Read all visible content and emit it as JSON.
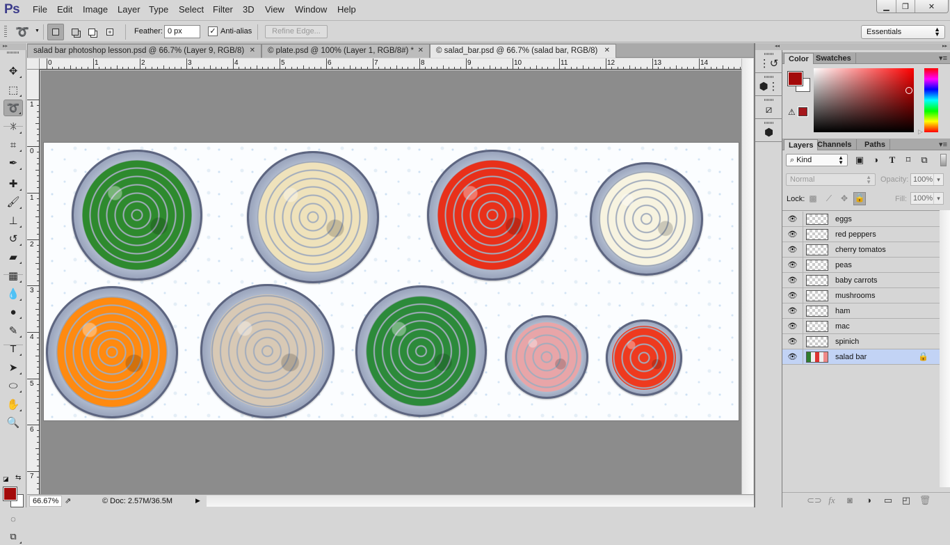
{
  "app": {
    "logo": "Ps",
    "menu": [
      "File",
      "Edit",
      "Image",
      "Layer",
      "Type",
      "Select",
      "Filter",
      "3D",
      "View",
      "Window",
      "Help"
    ],
    "window_controls": {
      "minimize": "▁",
      "restore": "❐",
      "close": "✕"
    }
  },
  "options_bar": {
    "tool_icon": "lasso-icon",
    "selection_modes": [
      "new-selection",
      "add-to-selection",
      "subtract-from-selection",
      "intersect-selection"
    ],
    "feather_label": "Feather:",
    "feather_value": "0 px",
    "antialias_label": "Anti-alias",
    "antialias_checked": true,
    "refine_edge_label": "Refine Edge...",
    "workspace": "Essentials"
  },
  "document_tabs": [
    {
      "label": "salad bar photoshop lesson.psd @ 66.7% (Layer 9, RGB/8)",
      "active": false
    },
    {
      "label": "© plate.psd @ 100% (Layer 1, RGB/8#) *",
      "active": false
    },
    {
      "label": "© salad_bar.psd @ 66.7% (salad bar, RGB/8)",
      "active": true
    }
  ],
  "rulers": {
    "top": [
      "0",
      "1",
      "2",
      "3",
      "4",
      "5",
      "6",
      "7",
      "8",
      "9",
      "10",
      "11",
      "12",
      "13",
      "14"
    ],
    "left": [
      "1",
      "0",
      "1",
      "2",
      "3",
      "4",
      "5",
      "6",
      "7"
    ]
  },
  "tools": [
    {
      "name": "move-tool",
      "glyph": "✥"
    },
    {
      "name": "marquee-tool",
      "glyph": "⬚"
    },
    {
      "name": "lasso-tool",
      "glyph": "➰",
      "active": true
    },
    {
      "name": "magic-wand-tool",
      "glyph": "✳"
    },
    {
      "name": "crop-tool",
      "glyph": "⌗"
    },
    {
      "name": "eyedropper-tool",
      "glyph": "✒"
    },
    {
      "name": "healing-brush-tool",
      "glyph": "✚"
    },
    {
      "name": "brush-tool",
      "glyph": "🖌"
    },
    {
      "name": "clone-stamp-tool",
      "glyph": "⊥"
    },
    {
      "name": "history-brush-tool",
      "glyph": "↺"
    },
    {
      "name": "eraser-tool",
      "glyph": "▰"
    },
    {
      "name": "gradient-tool",
      "glyph": "▦"
    },
    {
      "name": "blur-tool",
      "glyph": "💧"
    },
    {
      "name": "dodge-tool",
      "glyph": "●"
    },
    {
      "name": "pen-tool",
      "glyph": "✎"
    },
    {
      "name": "type-tool",
      "glyph": "T"
    },
    {
      "name": "path-selection-tool",
      "glyph": "➤"
    },
    {
      "name": "ellipse-tool",
      "glyph": "⬭"
    },
    {
      "name": "hand-tool",
      "glyph": "✋"
    },
    {
      "name": "zoom-tool",
      "glyph": "🔍"
    }
  ],
  "colors": {
    "foreground": "#a30a0a",
    "background": "#ffffff",
    "gamut_warning": "#a5171c"
  },
  "artwork": {
    "plates": [
      {
        "item": "spinach",
        "color": "#2e8a2e"
      },
      {
        "item": "mac",
        "color": "#efe2bb"
      },
      {
        "item": "red peppers",
        "color": "#e8301a"
      },
      {
        "item": "eggs",
        "color": "#f7f3e0"
      },
      {
        "item": "baby carrots",
        "color": "#ff8a10"
      },
      {
        "item": "mushrooms",
        "color": "#d8c9b5"
      },
      {
        "item": "peas",
        "color": "#2c8a3a"
      },
      {
        "item": "ham",
        "color": "#e8a5a8"
      },
      {
        "item": "cherry tomatos",
        "color": "#ee3a1f"
      }
    ]
  },
  "status_bar": {
    "zoom": "66.67%",
    "doc_info": "© Doc: 2.57M/36.5M"
  },
  "dock": [
    "history-icon",
    "3d-properties-icon",
    "transform-icon",
    "3d-cube-icon"
  ],
  "color_panel": {
    "tabs": [
      "Color",
      "Swatches"
    ],
    "active_tab": "Color"
  },
  "layers_panel": {
    "tabs": [
      "Layers",
      "Channels",
      "Paths"
    ],
    "active_tab": "Layers",
    "filter_kind": "Kind",
    "blend_mode": "Normal",
    "opacity_label": "Opacity:",
    "opacity": "100%",
    "lock_label": "Lock:",
    "fill_label": "Fill:",
    "fill": "100%",
    "layers": [
      {
        "name": "eggs",
        "visible": true,
        "selected": false,
        "locked": false
      },
      {
        "name": "red peppers",
        "visible": true,
        "selected": false,
        "locked": false
      },
      {
        "name": "cherry tomatos",
        "visible": true,
        "selected": false,
        "locked": false
      },
      {
        "name": "peas",
        "visible": true,
        "selected": false,
        "locked": false
      },
      {
        "name": "baby carrots",
        "visible": true,
        "selected": false,
        "locked": false
      },
      {
        "name": "mushrooms",
        "visible": true,
        "selected": false,
        "locked": false
      },
      {
        "name": "ham",
        "visible": true,
        "selected": false,
        "locked": false
      },
      {
        "name": "mac",
        "visible": true,
        "selected": false,
        "locked": false
      },
      {
        "name": "spinich",
        "visible": true,
        "selected": false,
        "locked": false
      },
      {
        "name": "salad bar",
        "visible": true,
        "selected": true,
        "locked": true
      }
    ]
  }
}
